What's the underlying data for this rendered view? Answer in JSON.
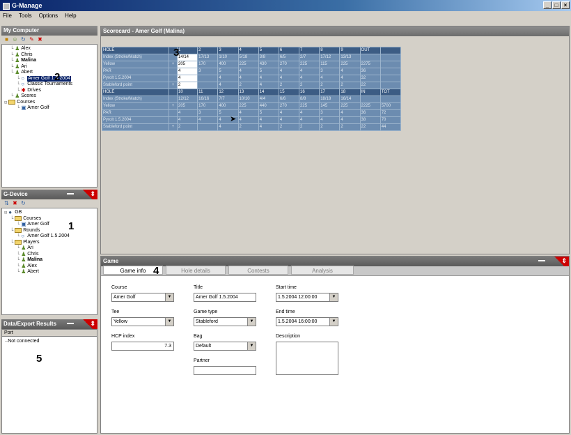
{
  "window": {
    "title": "G-Manage"
  },
  "menu": [
    "File",
    "Tools",
    "Options",
    "Help"
  ],
  "my_computer": {
    "title": "My Computer",
    "tree": [
      {
        "label": "Alex",
        "indent": 1,
        "icon": "person"
      },
      {
        "label": "Chris",
        "indent": 1,
        "icon": "person"
      },
      {
        "label": "Malina",
        "indent": 1,
        "icon": "person",
        "bold": true
      },
      {
        "label": "Ari",
        "indent": 1,
        "icon": "person"
      },
      {
        "label": "Abert",
        "indent": 1,
        "icon": "person"
      },
      {
        "label": "Amer Golf 1.5.2004",
        "indent": 2,
        "icon": "circle",
        "selected": true
      },
      {
        "label": "Classic Tournaments",
        "indent": 2,
        "icon": "circle"
      },
      {
        "label": "Drives",
        "indent": 2,
        "icon": "star"
      },
      {
        "label": "Scores",
        "indent": 1,
        "icon": "person"
      },
      {
        "label": "Courses",
        "indent": 0,
        "icon": "folder"
      },
      {
        "label": "Amer Golf",
        "indent": 2,
        "icon": "course"
      }
    ]
  },
  "g_device": {
    "title": "G-Device",
    "tree": [
      {
        "label": "GB",
        "indent": 0,
        "icon": "globe"
      },
      {
        "label": "Courses",
        "indent": 1,
        "icon": "folder"
      },
      {
        "label": "Amer Golf",
        "indent": 2,
        "icon": "course"
      },
      {
        "label": "Rounds",
        "indent": 1,
        "icon": "folder"
      },
      {
        "label": "Amer Golf 1.5.2004",
        "indent": 2,
        "icon": "circle"
      },
      {
        "label": "Players",
        "indent": 1,
        "icon": "folder"
      },
      {
        "label": "Ari",
        "indent": 2,
        "icon": "person"
      },
      {
        "label": "Chris",
        "indent": 2,
        "icon": "person"
      },
      {
        "label": "Malina",
        "indent": 2,
        "icon": "person",
        "bold": true
      },
      {
        "label": "Alex",
        "indent": 2,
        "icon": "person"
      },
      {
        "label": "Abert",
        "indent": 2,
        "icon": "person"
      }
    ]
  },
  "data_panel": {
    "title": "Data/Export Results",
    "column": "Port",
    "item": "Not connected"
  },
  "scorecard": {
    "title": "Scorecard - Amer Golf (Malina)",
    "rows": [
      {
        "type": "hdr",
        "label": "HOLE",
        "cells": [
          "1",
          "2",
          "3",
          "4",
          "5",
          "6",
          "7",
          "8",
          "9",
          "OUT",
          ""
        ]
      },
      {
        "label": "Index (Stroke/Match)",
        "cells": [
          "14/14",
          "17/13",
          "1/10",
          "5/18",
          "3/8",
          "6/5",
          "2/7",
          "17/12",
          "13/13",
          "",
          ""
        ]
      },
      {
        "label": "Yellow",
        "cur": "+",
        "cells": [
          "205",
          "170",
          "400",
          "225",
          "430",
          "270",
          "225",
          "115",
          "225",
          "2275",
          ""
        ]
      },
      {
        "label": "PAR",
        "cells": [
          "4",
          "3",
          "5",
          "4",
          "5",
          "4",
          "4",
          "3",
          "4",
          "36",
          ""
        ]
      },
      {
        "label": "Pyrolt 1.5.2004",
        "cells": [
          "4",
          "",
          "4",
          "4",
          "4",
          "4",
          "4",
          "4",
          "4",
          "32",
          ""
        ]
      },
      {
        "label": "Stableford point",
        "cur": "+",
        "cells": [
          "2",
          "",
          "4",
          "2",
          "4",
          "2",
          "2",
          "2",
          "2",
          "22",
          ""
        ]
      },
      {
        "type": "hdr",
        "label": "HOLE",
        "cells": [
          "10",
          "11",
          "12",
          "13",
          "14",
          "15",
          "16",
          "17",
          "18",
          "IN",
          "TOT"
        ]
      },
      {
        "label": "Index (Stroke/Match)",
        "cells": [
          "12/12",
          "16/16",
          "7/7",
          "10/10",
          "4/4",
          "6/6",
          "8/8",
          "18/18",
          "16/14",
          "",
          ""
        ]
      },
      {
        "label": "Yellow",
        "cur": "+",
        "cells": [
          "205",
          "170",
          "400",
          "225",
          "440",
          "270",
          "225",
          "145",
          "225",
          "2225",
          "5700"
        ]
      },
      {
        "label": "PAR",
        "cells": [
          "4",
          "3",
          "5",
          "4",
          "5",
          "4",
          "4",
          "3",
          "4",
          "36",
          "72"
        ]
      },
      {
        "label": "Pyrolt 1.5.2004",
        "cells": [
          "4",
          "4",
          "4",
          "4",
          "4",
          "4",
          "4",
          "4",
          "4",
          "38",
          "70"
        ]
      },
      {
        "label": "Stableford point",
        "cur": "+",
        "cells": [
          "2",
          "",
          "4",
          "2",
          "4",
          "2",
          "2",
          "2",
          "2",
          "22",
          "44"
        ]
      }
    ]
  },
  "game_panel": {
    "title": "Game",
    "tabs": [
      "Game info",
      "Hole details",
      "Contests",
      "Analysis"
    ],
    "fields": {
      "course": {
        "label": "Course",
        "value": "Amer Golf"
      },
      "tee": {
        "label": "Tee",
        "value": "Yellow"
      },
      "hcp": {
        "label": "HCP index",
        "value": "7.3"
      },
      "title": {
        "label": "Title",
        "value": "Amer Golf 1.5.2004"
      },
      "game_type": {
        "label": "Game type",
        "value": "Stableford"
      },
      "bag": {
        "label": "Bag",
        "value": "Default"
      },
      "partner": {
        "label": "Partner",
        "value": ""
      },
      "start": {
        "label": "Start time",
        "value": "1.5.2004 12:00:00"
      },
      "end": {
        "label": "End time",
        "value": "1.5.2004 16:00:00"
      },
      "description": {
        "label": "Description",
        "value": ""
      }
    }
  },
  "callouts": [
    "1",
    "2",
    "3",
    "4",
    "5"
  ]
}
